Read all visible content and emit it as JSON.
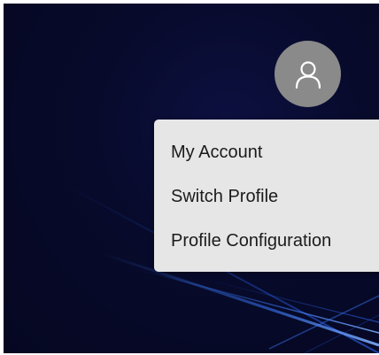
{
  "profile": {
    "avatar_icon": "user-icon",
    "avatar_color": "#8a8a8a"
  },
  "menu": {
    "items": [
      {
        "label": "My Account"
      },
      {
        "label": "Switch Profile"
      },
      {
        "label": "Profile Configuration"
      }
    ],
    "background": "#e6e6e6"
  },
  "wallpaper": {
    "base_color": "#070a2a",
    "streak_color": "#3a7bff"
  }
}
